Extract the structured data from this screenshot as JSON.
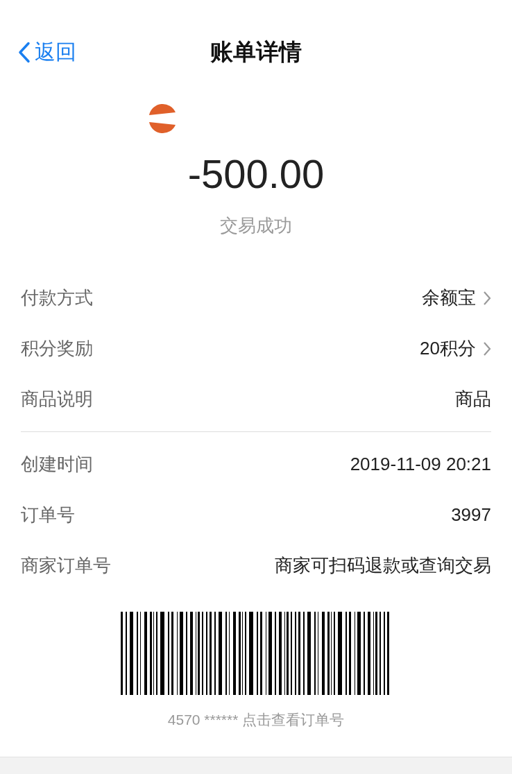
{
  "nav": {
    "back": "返回",
    "title": "账单详情"
  },
  "summary": {
    "amount": "-500.00",
    "status": "交易成功"
  },
  "groups": [
    {
      "rows": [
        {
          "label": "付款方式",
          "value": "余额宝",
          "chevron": true
        },
        {
          "label": "积分奖励",
          "value": "20积分",
          "chevron": true
        },
        {
          "label": "商品说明",
          "value": "商品",
          "chevron": false
        }
      ]
    },
    {
      "rows": [
        {
          "label": "创建时间",
          "value": "2019-11-09 20:21",
          "chevron": false
        },
        {
          "label": "订单号",
          "value": "3997",
          "chevron": false
        },
        {
          "label": "商家订单号",
          "value": "商家可扫码退款或查询交易",
          "chevron": false
        }
      ]
    }
  ],
  "barcode": {
    "caption": "4570 ****** 点击查看订单号"
  }
}
